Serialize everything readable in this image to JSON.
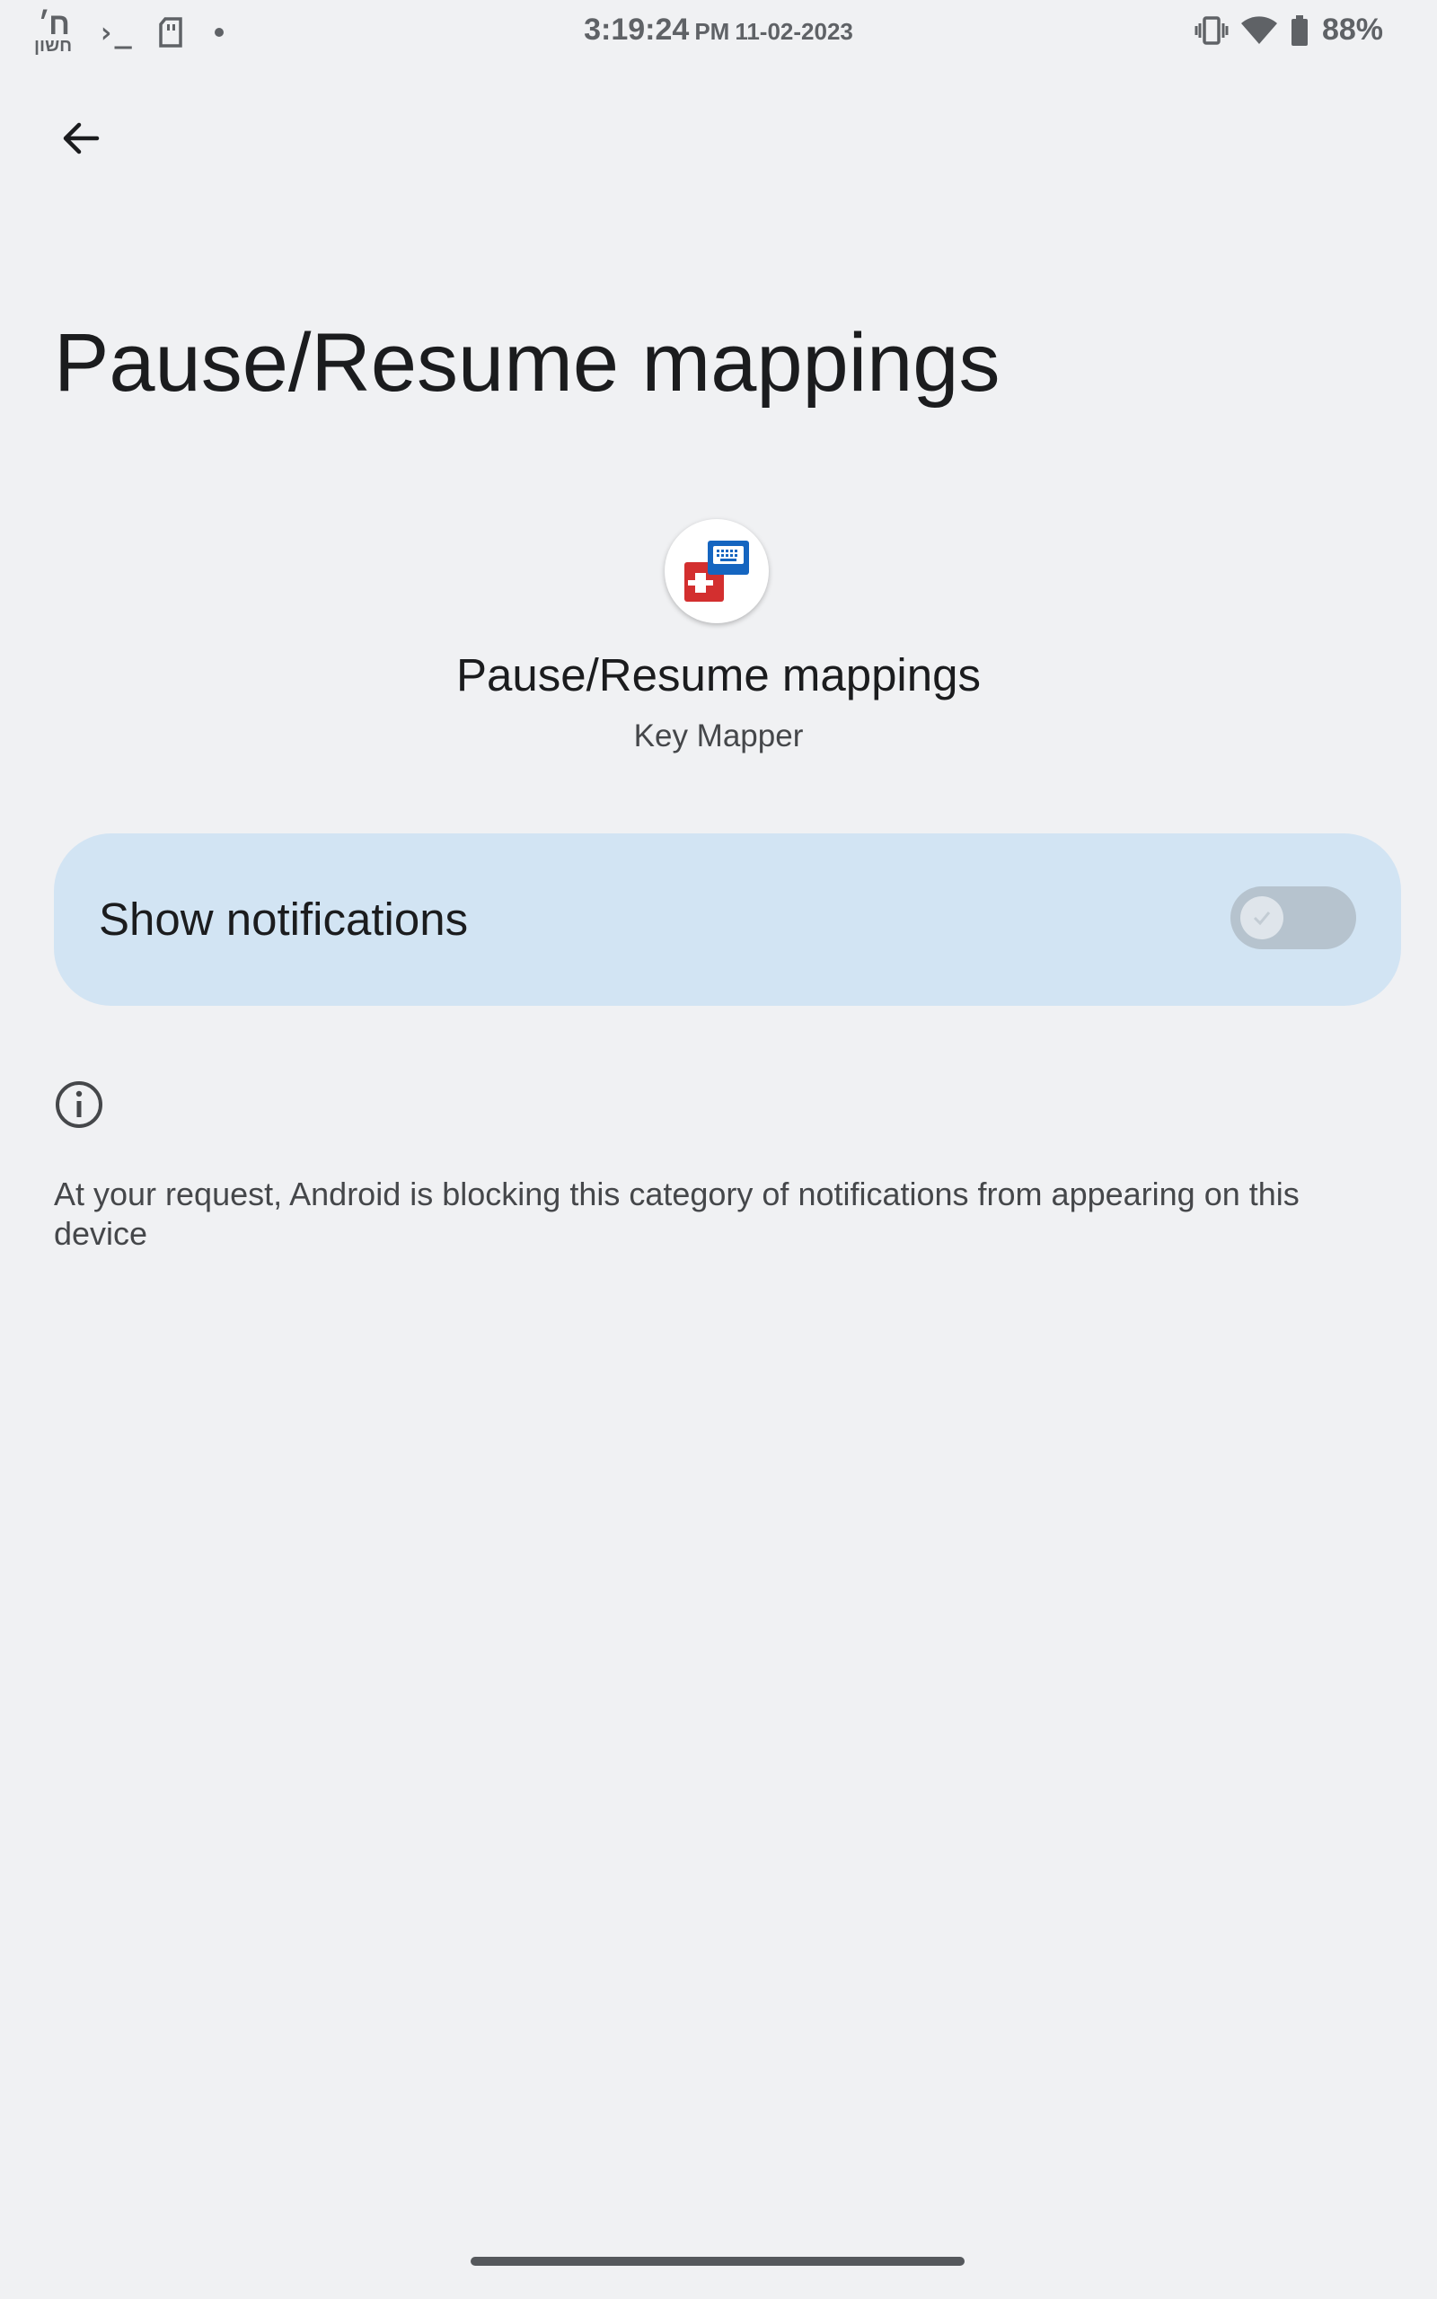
{
  "status_bar": {
    "hebrew_date_top": "ח׳",
    "hebrew_date_bottom": "חשון",
    "terminal_glyph": "›_",
    "time": "3:19:24",
    "ampm": "PM",
    "date": "11-02-2023",
    "battery_percent": "88%"
  },
  "header": {
    "back_icon": "arrow-back-icon"
  },
  "page": {
    "title": "Pause/Resume mappings",
    "channel_name": "Pause/Resume mappings",
    "app_name": "Key Mapper"
  },
  "toggle": {
    "label": "Show notifications",
    "enabled": false
  },
  "info": {
    "icon": "info-icon",
    "text": "At your request, Android is blocking this category of notifications from appearing on this device"
  },
  "colors": {
    "background": "#f0f1f3",
    "card": "#d2e4f3",
    "switch_track": "#b6c3ce",
    "app_icon_red": "#d32f2f",
    "app_icon_blue": "#1565c0"
  }
}
